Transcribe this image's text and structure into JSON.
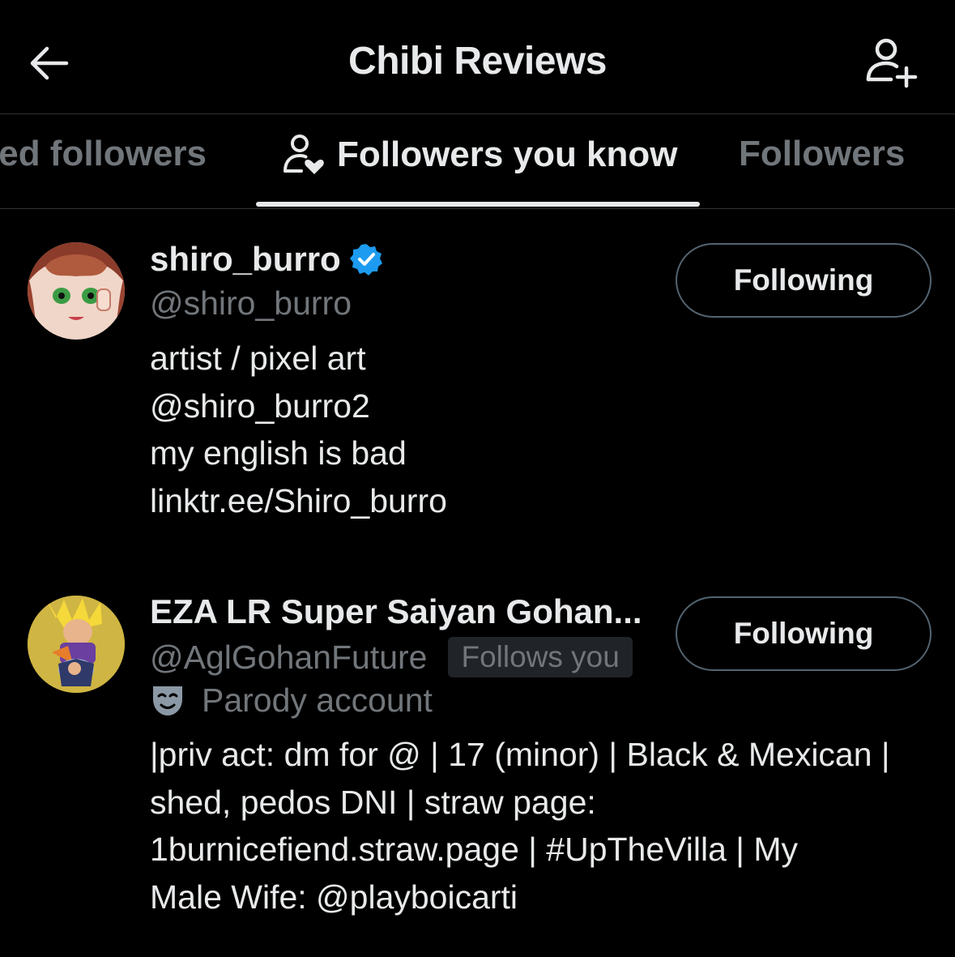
{
  "header": {
    "title": "Chibi Reviews"
  },
  "tabs": [
    {
      "label": "ied followers",
      "active": false
    },
    {
      "label": "Followers you know",
      "active": true
    },
    {
      "label": "Followers",
      "active": false
    }
  ],
  "users": [
    {
      "display_name": "shiro_burro",
      "verified": true,
      "handle": "@shiro_burro",
      "follows_you": null,
      "button_label": "Following",
      "parody": null,
      "bio": "artist / pixel art\n@shiro_burro2\nmy english is bad\nlinktr.ee/Shiro_burro"
    },
    {
      "display_name": "EZA LR Super Saiyan Gohan...",
      "verified": false,
      "handle": "@AglGohanFuture",
      "follows_you": "Follows you",
      "button_label": "Following",
      "parody": "Parody account",
      "bio": "|priv act: dm for @ | 17 (minor) | Black & Mexican |\nshed, pedos DNI | straw page:\n1burnicefiend.straw.page | #UpTheVilla | My\nMale Wife: @playboicarti"
    }
  ],
  "colors": {
    "background": "#000000",
    "primary_text": "#e7e9ea",
    "secondary_text": "#71767b",
    "verified_badge": "#1d9bf0",
    "divider": "#2f3336"
  }
}
